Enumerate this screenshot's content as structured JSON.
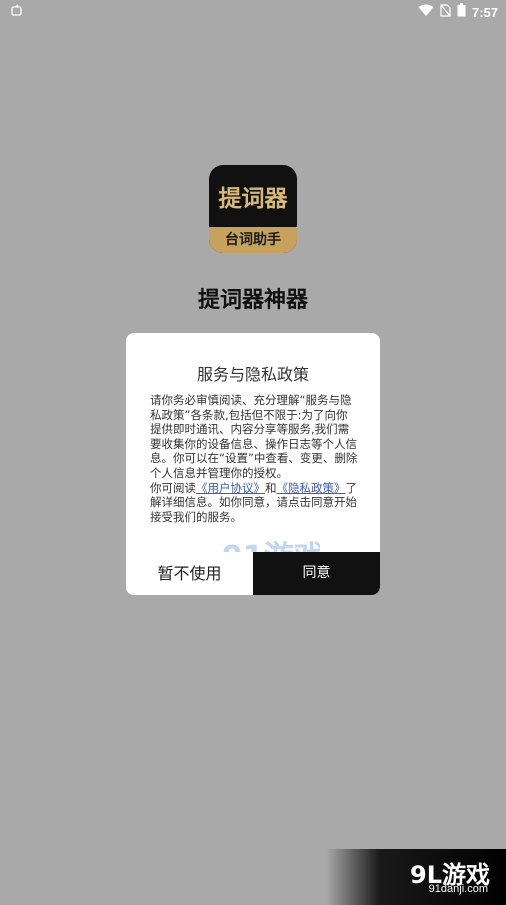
{
  "status_bar": {
    "time": "7:57",
    "icons": [
      "wifi-icon",
      "no-sim-icon",
      "battery-icon"
    ]
  },
  "app": {
    "icon_title": "提词器",
    "icon_subtitle": "台词助手",
    "name": "提词器神器"
  },
  "dialog": {
    "title": "服务与隐私政策",
    "paragraph1": "请你务必审慎阅读、充分理解“服务与隐私政策”各条款,包括但不限于:为了向你提供即时通讯、内容分享等服务,我们需要收集你的设备信息、操作日志等个人信息。你可以在“设置”中查看、变更、删除个人信息并管理你的授权。",
    "paragraph2_prefix": "你可阅读",
    "user_agreement_link": "《用户协议》",
    "and_text": "和",
    "privacy_policy_link": "《隐私政策》",
    "paragraph2_suffix": "了解详细信息。如你同意，请点击同意开始接受我们的服务。",
    "cancel_label": "暂不使用",
    "agree_label": "同意",
    "watermark_text": "91游戏",
    "watermark_sub": "91danji"
  },
  "watermark": {
    "main": "9L游戏",
    "sub": "91danji.com"
  }
}
